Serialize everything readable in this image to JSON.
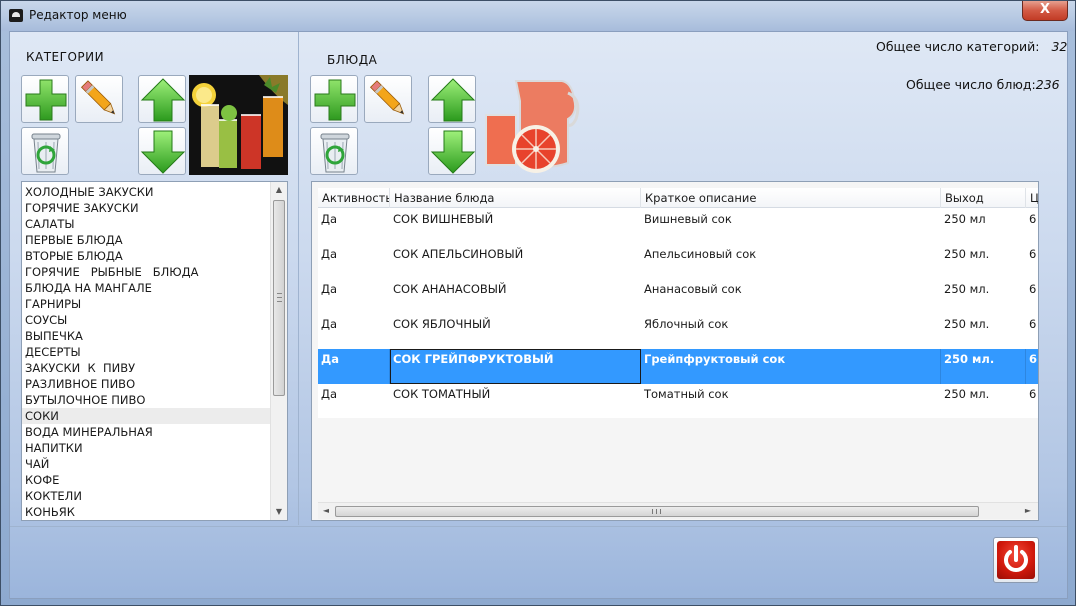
{
  "window": {
    "title": "Редактор меню",
    "close_glyph": "X"
  },
  "categories_panel": {
    "label": "КАТЕГОРИИ",
    "toolbar": [
      {
        "name": "add-category-button",
        "icon": "plus-icon"
      },
      {
        "name": "edit-category-button",
        "icon": "pencil-icon"
      },
      {
        "name": "move-category-up-button",
        "icon": "arrow-up-icon"
      },
      {
        "name": "delete-category-button",
        "icon": "recycle-bin-icon"
      },
      {
        "name": "move-category-down-button",
        "icon": "arrow-down-icon"
      }
    ],
    "items": [
      "ХОЛОДНЫЕ ЗАКУСКИ",
      "ГОРЯЧИЕ ЗАКУСКИ",
      "САЛАТЫ",
      "ПЕРВЫЕ БЛЮДА",
      "ВТОРЫЕ БЛЮДА",
      "ГОРЯЧИЕ   РЫБНЫЕ   БЛЮДА",
      "БЛЮДА НА МАНГАЛЕ",
      "ГАРНИРЫ",
      "СОУСЫ",
      "ВЫПЕЧКА",
      "ДЕСЕРТЫ",
      "ЗАКУСКИ  К  ПИВУ",
      "РАЗЛИВНОЕ ПИВО",
      "БУТЫЛОЧНОЕ ПИВО",
      "СОКИ",
      "ВОДА МИНЕРАЛЬНАЯ",
      "НАПИТКИ",
      "ЧАЙ",
      "КОФЕ",
      "КОКТЕЛИ",
      "КОНЬЯК"
    ],
    "selected_index": 14
  },
  "dishes_panel": {
    "label": "БЛЮДА",
    "toolbar": [
      {
        "name": "add-dish-button",
        "icon": "plus-icon"
      },
      {
        "name": "edit-dish-button",
        "icon": "pencil-icon"
      },
      {
        "name": "move-dish-up-button",
        "icon": "arrow-up-icon"
      },
      {
        "name": "delete-dish-button",
        "icon": "recycle-bin-icon"
      },
      {
        "name": "move-dish-down-button",
        "icon": "arrow-down-icon"
      }
    ],
    "columns": [
      "Активность",
      "Название блюда",
      "Краткое описание",
      "Выход",
      "Ц"
    ],
    "rows": [
      {
        "active": "Да",
        "name": "СОК ВИШНЕВЫЙ",
        "description": "Вишневый сок",
        "yield": "250 мл",
        "price": "6"
      },
      {
        "active": "Да",
        "name": "СОК АПЕЛЬСИНОВЫЙ",
        "description": "Апельсиновый сок",
        "yield": "250 мл.",
        "price": "6"
      },
      {
        "active": "Да",
        "name": "СОК АНАНАСОВЫЙ",
        "description": "Ананасовый сок",
        "yield": "250 мл.",
        "price": "6"
      },
      {
        "active": "Да",
        "name": "СОК ЯБЛОЧНЫЙ",
        "description": "Яблочный сок",
        "yield": "250 мл.",
        "price": "6"
      },
      {
        "active": "Да",
        "name": "СОК ГРЕЙПФРУКТОВЫЙ",
        "description": "Грейпфруктовый сок",
        "yield": "250 мл.",
        "price": "6"
      },
      {
        "active": "Да",
        "name": "СОК ТОМАТНЫЙ",
        "description": "Томатный сок",
        "yield": "250 мл.",
        "price": "6"
      }
    ],
    "selected_row": 4
  },
  "stats": {
    "categories_label": "Общее число категорий:",
    "categories_value": "32",
    "dishes_label": "Общее число блюд:",
    "dishes_value": "236"
  },
  "scroll_glyphs": {
    "up": "▲",
    "down": "▼",
    "left": "◄",
    "right": "►"
  },
  "exit_button": {
    "icon": "power-icon"
  },
  "colors": {
    "selection": "#3399ff",
    "accent_green": "#3cb043",
    "power_red": "#d1190c"
  }
}
